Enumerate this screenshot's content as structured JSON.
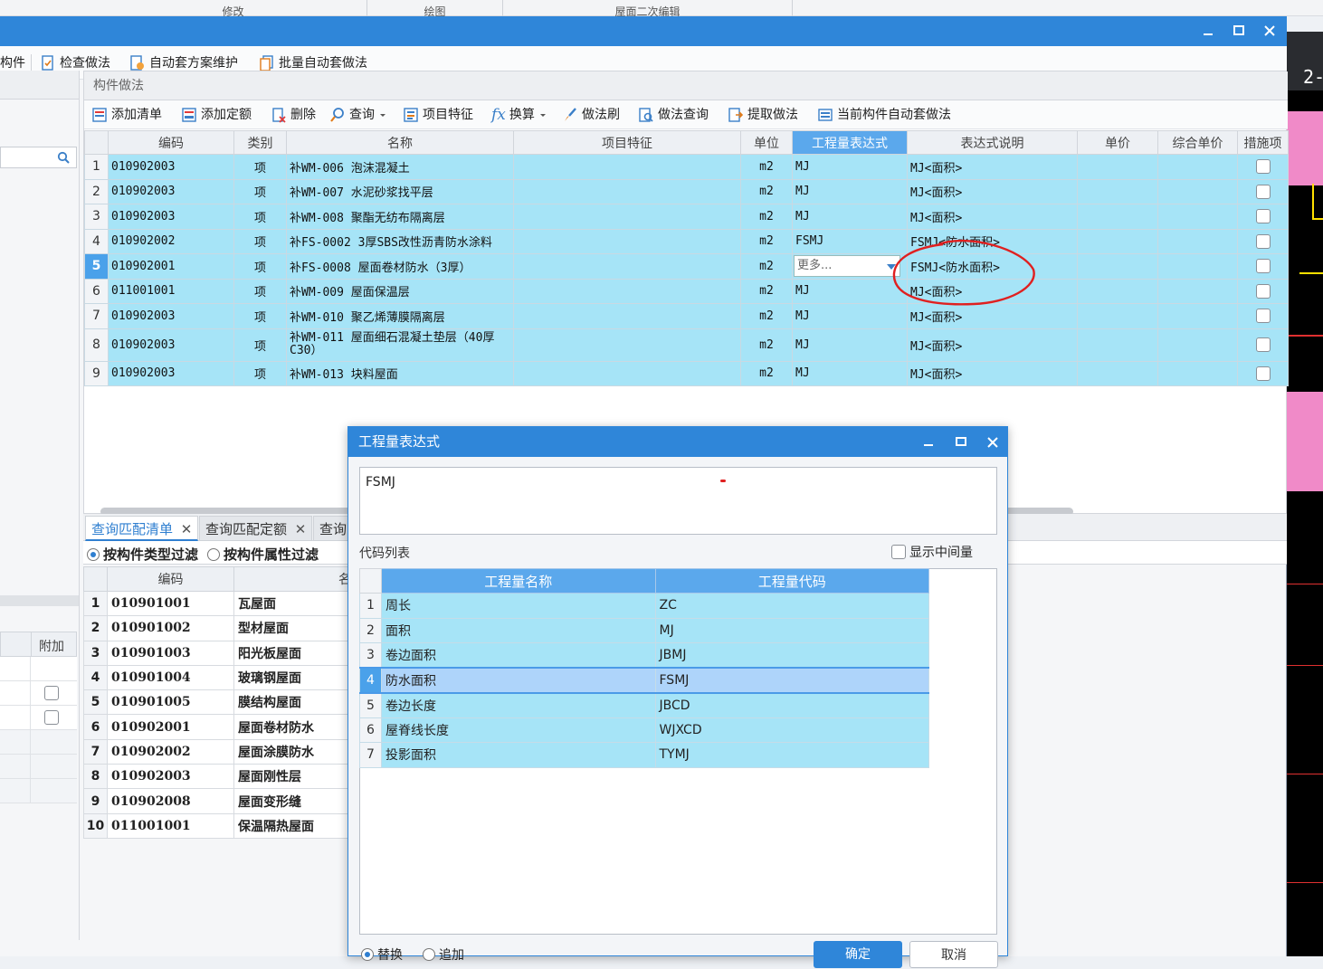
{
  "top_strip": {
    "seg1": "修改",
    "seg2": "绘图",
    "seg3": "屋面二次编辑"
  },
  "toolbar1": {
    "partial_item": "构件",
    "check_method": "检查做法",
    "auto_plan_maintain": "自动套方案维护",
    "batch_auto": "批量自动套做法"
  },
  "cad": {
    "label": "2-"
  },
  "component_panel": {
    "title": "构件做法",
    "toolbar": {
      "add_list": "添加清单",
      "add_quota": "添加定额",
      "delete": "删除",
      "query": "查询",
      "item_feature": "项目特征",
      "convert": "换算",
      "method_brush": "做法刷",
      "method_query": "做法查询",
      "extract_method": "提取做法",
      "current_auto": "当前构件自动套做法"
    },
    "columns": [
      "编码",
      "类别",
      "名称",
      "项目特征",
      "单位",
      "工程量表达式",
      "表达式说明",
      "单价",
      "综合单价",
      "措施项"
    ],
    "rows": [
      {
        "n": "1",
        "code": "010902003",
        "type": "项",
        "name": "补WM-006 泡沫混凝土",
        "unit": "m2",
        "expr": "MJ",
        "desc": "MJ<面积>"
      },
      {
        "n": "2",
        "code": "010902003",
        "type": "项",
        "name": "补WM-007 水泥砂浆找平层",
        "unit": "m2",
        "expr": "MJ",
        "desc": "MJ<面积>"
      },
      {
        "n": "3",
        "code": "010902003",
        "type": "项",
        "name": "补WM-008 聚酯无纺布隔离层",
        "unit": "m2",
        "expr": "MJ",
        "desc": "MJ<面积>"
      },
      {
        "n": "4",
        "code": "010902002",
        "type": "项",
        "name": "补FS-0002 3厚SBS改性沥青防水涂料",
        "unit": "m2",
        "expr": "FSMJ",
        "desc": "FSMJ<防水面积>"
      },
      {
        "n": "5",
        "code": "010902001",
        "type": "项",
        "name": "补FS-0008 屋面卷材防水（3厚）",
        "unit": "m2",
        "expr": "更多...",
        "desc": "FSMJ<防水面积>"
      },
      {
        "n": "6",
        "code": "011001001",
        "type": "项",
        "name": "补WM-009 屋面保温层",
        "unit": "m2",
        "expr": "MJ",
        "desc": "MJ<面积>"
      },
      {
        "n": "7",
        "code": "010902003",
        "type": "项",
        "name": "补WM-010 聚乙烯薄膜隔离层",
        "unit": "m2",
        "expr": "MJ",
        "desc": "MJ<面积>"
      },
      {
        "n": "8",
        "code": "010902003",
        "type": "项",
        "name": "补WM-011 屋面细石混凝土垫层（40厚C30）",
        "unit": "m2",
        "expr": "MJ",
        "desc": "MJ<面积>"
      },
      {
        "n": "9",
        "code": "010902003",
        "type": "项",
        "name": "补WM-013 块料屋面",
        "unit": "m2",
        "expr": "MJ",
        "desc": "MJ<面积>"
      }
    ]
  },
  "bottom": {
    "tabs": [
      "查询匹配清单",
      "查询匹配定额",
      "查询"
    ],
    "filter_type": "按构件类型过滤",
    "filter_attr": "按构件属性过滤",
    "columns": [
      "编码",
      "名"
    ],
    "rows": [
      {
        "n": "1",
        "code": "010901001",
        "name": "瓦屋面"
      },
      {
        "n": "2",
        "code": "010901002",
        "name": "型材屋面"
      },
      {
        "n": "3",
        "code": "010901003",
        "name": "阳光板屋面"
      },
      {
        "n": "4",
        "code": "010901004",
        "name": "玻璃钢屋面"
      },
      {
        "n": "5",
        "code": "010901005",
        "name": "膜结构屋面"
      },
      {
        "n": "6",
        "code": "010902001",
        "name": "屋面卷材防水"
      },
      {
        "n": "7",
        "code": "010902002",
        "name": "屋面涂膜防水"
      },
      {
        "n": "8",
        "code": "010902003",
        "name": "屋面刚性层"
      },
      {
        "n": "9",
        "code": "010902008",
        "name": "屋面变形缝"
      },
      {
        "n": "10",
        "code": "011001001",
        "name": "保温隔热屋面"
      }
    ]
  },
  "left_panel": {
    "attach_header": "附加"
  },
  "dialog": {
    "title": "工程量表达式",
    "expression": "FSMJ",
    "code_list_label": "代码列表",
    "show_intermediate": "显示中间量",
    "columns": [
      "工程量名称",
      "工程量代码"
    ],
    "rows": [
      {
        "n": "1",
        "name": "周长",
        "code": "ZC"
      },
      {
        "n": "2",
        "name": "面积",
        "code": "MJ"
      },
      {
        "n": "3",
        "name": "卷边面积",
        "code": "JBMJ"
      },
      {
        "n": "4",
        "name": "防水面积",
        "code": "FSMJ"
      },
      {
        "n": "5",
        "name": "卷边长度",
        "code": "JBCD"
      },
      {
        "n": "6",
        "name": "屋脊线长度",
        "code": "WJXCD"
      },
      {
        "n": "7",
        "name": "投影面积",
        "code": "TYMJ"
      }
    ],
    "replace": "替换",
    "append": "追加",
    "ok": "确定",
    "cancel": "取消"
  }
}
